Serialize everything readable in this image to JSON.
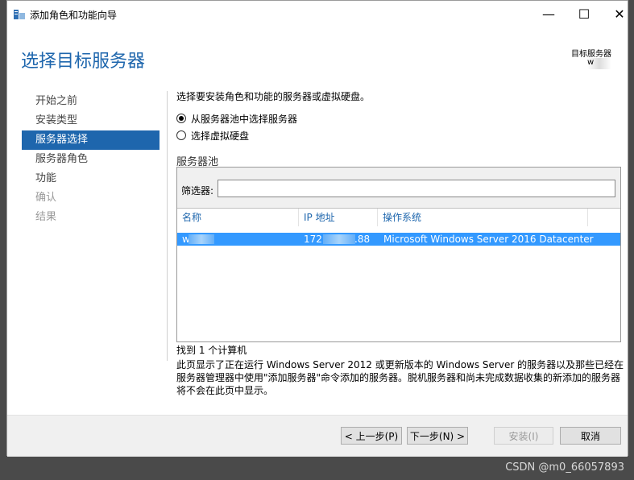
{
  "window": {
    "title": "添加角色和功能向导",
    "minimize_glyph": "—",
    "maximize_glyph": "☐",
    "close_glyph": "✕"
  },
  "header": {
    "heading": "选择目标服务器",
    "destination_label": "目标服务器",
    "destination_value": "w"
  },
  "nav": {
    "items": [
      {
        "label": "开始之前",
        "state": "normal"
      },
      {
        "label": "安装类型",
        "state": "normal"
      },
      {
        "label": "服务器选择",
        "state": "active"
      },
      {
        "label": "服务器角色",
        "state": "normal"
      },
      {
        "label": "功能",
        "state": "normal"
      },
      {
        "label": "确认",
        "state": "disabled"
      },
      {
        "label": "结果",
        "state": "disabled"
      }
    ]
  },
  "content": {
    "intro": "选择要安装角色和功能的服务器或虚拟硬盘。",
    "radio_pool": "从服务器池中选择服务器",
    "radio_vhd": "选择虚拟硬盘",
    "pool_title": "服务器池",
    "filter_label": "筛选器:",
    "filter_value": "",
    "columns": {
      "name": "名称",
      "ip": "IP 地址",
      "os": "操作系统"
    },
    "row": {
      "name": "w",
      "ip_prefix": "172",
      "ip_suffix": ".88",
      "os": "Microsoft Windows Server 2016 Datacenter"
    },
    "found": "找到 1 个计算机",
    "description": "此页显示了正在运行 Windows Server 2012 或更新版本的 Windows Server 的服务器以及那些已经在服务器管理器中使用\"添加服务器\"命令添加的服务器。脱机服务器和尚未完成数据收集的新添加的服务器将不会在此页中显示。"
  },
  "buttons": {
    "prev": "< 上一步(P)",
    "next": "下一步(N) >",
    "install": "安装(I)",
    "cancel": "取消"
  },
  "watermark": "CSDN @m0_66057893",
  "colors": {
    "accent": "#1e66ad",
    "selection": "#3399ff"
  }
}
